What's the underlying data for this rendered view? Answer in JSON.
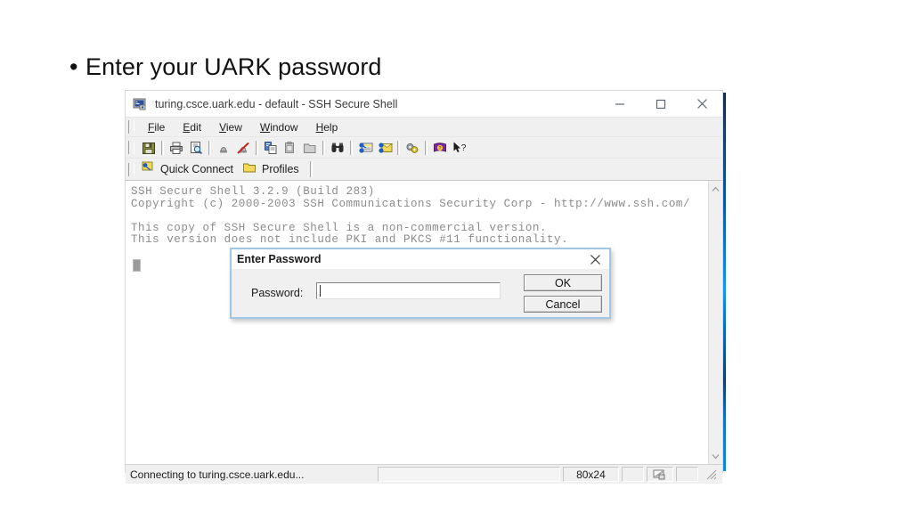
{
  "slide": {
    "bullet_marker": "•",
    "bullet_text": "Enter your UARK password"
  },
  "window": {
    "title": "turing.csce.uark.edu - default - SSH Secure Shell",
    "title_icon": "ssh-terminal-icon",
    "controls": [
      {
        "name": "minimize",
        "glyph": "minimize-icon"
      },
      {
        "name": "maximize",
        "glyph": "maximize-icon"
      },
      {
        "name": "close",
        "glyph": "close-icon"
      }
    ],
    "menu": [
      {
        "accel": "F",
        "rest": "ile"
      },
      {
        "accel": "E",
        "rest": "dit"
      },
      {
        "accel": "V",
        "rest": "iew"
      },
      {
        "accel": "W",
        "rest": "indow"
      },
      {
        "accel": "H",
        "rest": "elp"
      }
    ],
    "toolbar": [
      {
        "name": "save-icon",
        "label": "Save"
      },
      {
        "sep": true
      },
      {
        "name": "print-icon",
        "label": "Print"
      },
      {
        "name": "print-preview-icon",
        "label": "Print Preview"
      },
      {
        "sep": true
      },
      {
        "name": "connect-icon",
        "label": "Connect"
      },
      {
        "name": "disconnect-icon",
        "label": "Disconnect"
      },
      {
        "sep": true
      },
      {
        "name": "copy-icon",
        "label": "Copy"
      },
      {
        "name": "paste-icon",
        "label": "Paste"
      },
      {
        "name": "open-folder-icon",
        "label": "Open"
      },
      {
        "sep": true
      },
      {
        "name": "find-icon",
        "label": "Find"
      },
      {
        "sep": true
      },
      {
        "name": "new-file-transfer-icon",
        "label": "New File Transfer Window"
      },
      {
        "name": "new-terminal-icon",
        "label": "New Terminal Window"
      },
      {
        "sep": true
      },
      {
        "name": "settings-icon",
        "label": "Settings"
      },
      {
        "sep": true
      },
      {
        "name": "help-book-icon",
        "label": "Help"
      },
      {
        "name": "context-help-icon",
        "label": "Context Help"
      }
    ],
    "quick_bar": {
      "quick_connect_label": "Quick Connect",
      "quick_connect_icon": "quick-connect-icon",
      "profiles_label": "Profiles",
      "profiles_icon": "folder-icon"
    },
    "terminal": {
      "lines": [
        "SSH Secure Shell 3.2.9 (Build 283)",
        "Copyright (c) 2000-2003 SSH Communications Security Corp - http://www.ssh.com/",
        "",
        "This copy of SSH Secure Shell is a non-commercial version.",
        "This version does not include PKI and PKCS #11 functionality."
      ]
    },
    "scrollbar": {
      "up_icon": "chevron-up-icon",
      "down_icon": "chevron-down-icon"
    },
    "status": {
      "message": "Connecting to turing.csce.uark.edu...",
      "terminal_size": "80x24",
      "encryption_icon": "ssh-status-icon",
      "resize_grip_icon": "resize-grip-icon"
    }
  },
  "dialog": {
    "title": "Enter Password",
    "close_icon": "close-icon",
    "password_label": "Password:",
    "password_value": "",
    "password_placeholder": "",
    "ok_label": "OK",
    "cancel_label": "Cancel"
  },
  "colors": {
    "accent_blue": "#0e7fd4",
    "dialog_border": "#9fc8e8",
    "terminal_text": "#8c8c8c",
    "chrome": "#f0f0f0"
  }
}
